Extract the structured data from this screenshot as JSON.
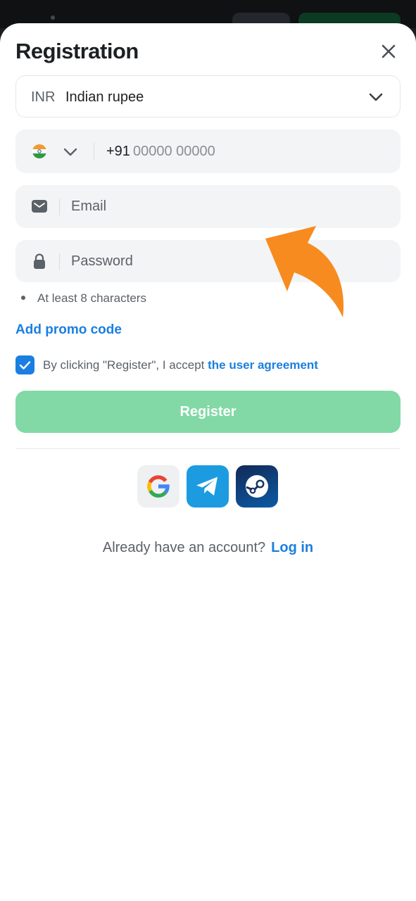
{
  "modal": {
    "title": "Registration"
  },
  "currency": {
    "code": "INR",
    "name": "Indian rupee"
  },
  "phone": {
    "country_prefix": "+91",
    "placeholder": "00000 00000"
  },
  "email": {
    "placeholder": "Email"
  },
  "password": {
    "placeholder": "Password",
    "hint": "At least 8 characters"
  },
  "promo": {
    "label": "Add promo code"
  },
  "agreement": {
    "checked": true,
    "text": "By clicking \"Register\", I accept ",
    "link": "the user agreement"
  },
  "register_button": {
    "label": "Register"
  },
  "social_login": {
    "providers": [
      "google-icon",
      "telegram-icon",
      "steam-icon"
    ]
  },
  "footer": {
    "question": "Already have an account?",
    "login_link": "Log in"
  },
  "colors": {
    "accent": "#1a7fe0",
    "register_bg": "#82d9a6",
    "arrow": "#f78b1f"
  }
}
